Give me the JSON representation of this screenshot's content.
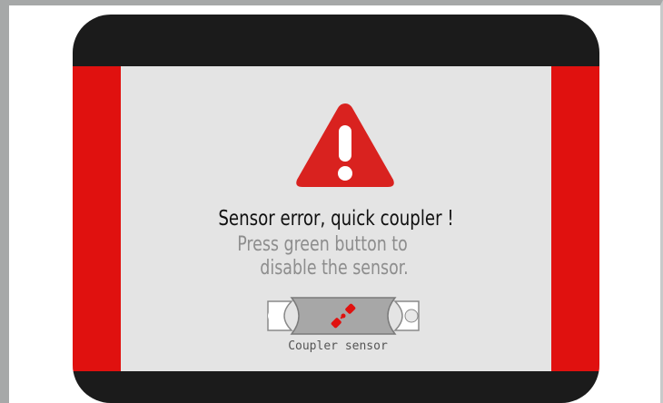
{
  "alert": {
    "title": "Sensor error, quick coupler !",
    "instruction_line1": "Press green button to",
    "instruction_line2": "disable the sensor.",
    "icon": "warning-icon",
    "icon_color": "#d9221f"
  },
  "sensor": {
    "label": "Coupler sensor",
    "icon": "coupler-sensor-icon"
  },
  "colors": {
    "bezel": "#1b1b1b",
    "screen_bg": "#e4e4e4",
    "side_bars": "#e0110f",
    "title_text": "#111111",
    "instruction_text": "#8d8d8d"
  }
}
